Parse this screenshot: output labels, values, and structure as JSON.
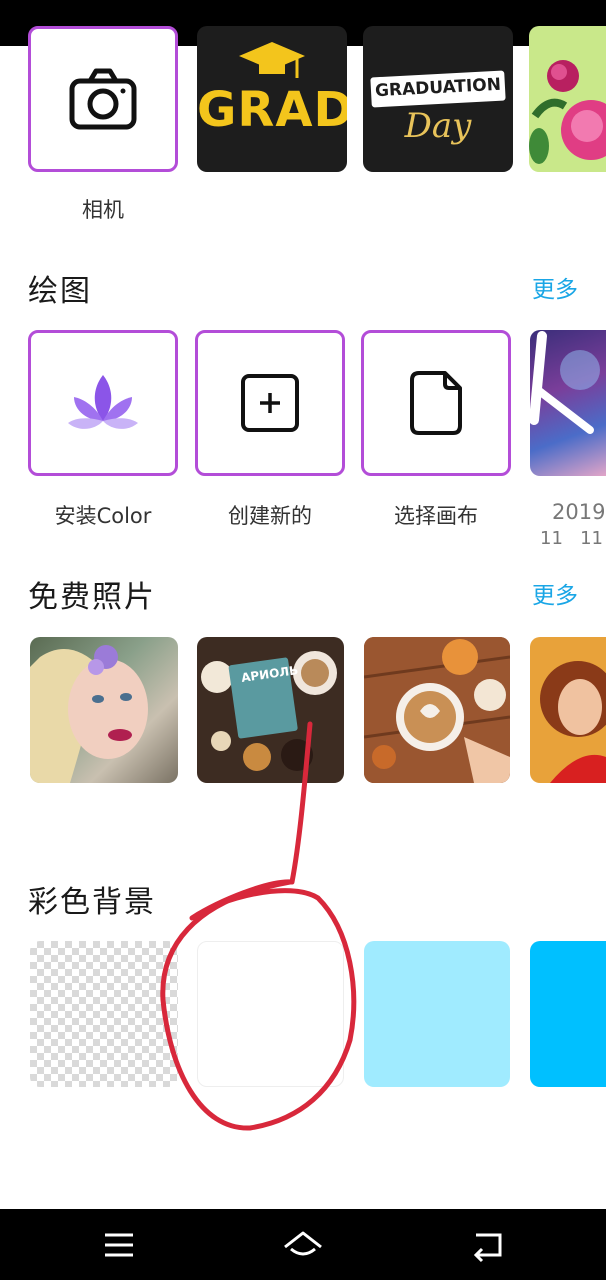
{
  "top_row": {
    "camera_label": "相机",
    "templates": [
      {
        "text": "GRAD"
      },
      {
        "text_top": "GRADUATION",
        "text_script": "Day"
      }
    ]
  },
  "drawing": {
    "title": "绘图",
    "more": "更多",
    "items": [
      {
        "label": "安装Color",
        "icon": "lotus-icon"
      },
      {
        "label": "创建新的",
        "icon": "plus-square-icon"
      },
      {
        "label": "选择画布",
        "icon": "file-icon"
      },
      {
        "label": "2019",
        "sub": "11   11",
        "icon": "artwork-thumbnail"
      }
    ]
  },
  "photos": {
    "title": "免费照片",
    "more": "更多",
    "book_text": "АРИОЛЬ"
  },
  "backgrounds": {
    "title": "彩色背景",
    "swatches": [
      "transparent",
      "#ffffff",
      "#a0ebff",
      "#00c0ff"
    ]
  },
  "annotation": {
    "color": "#d8283b"
  },
  "nav": {
    "icons": [
      "menu-icon",
      "home-icon",
      "back-icon"
    ]
  }
}
